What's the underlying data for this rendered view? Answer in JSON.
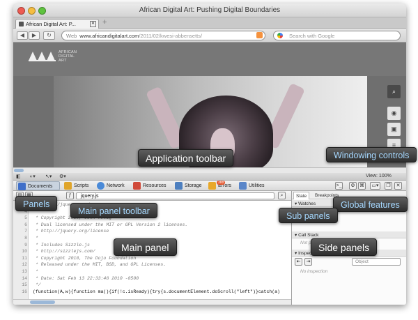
{
  "window": {
    "title": "African Digital Art: Pushing Digital Boundaries",
    "tab_label": "African Digital Art: P...",
    "new_tab": "+"
  },
  "navbar": {
    "back": "◀",
    "forward": "▶",
    "reload": "↻",
    "url_prefix": "Web",
    "url_host": "www.africandigitalart.com",
    "url_path": "/2011/02/kwesi-abbensetts/",
    "search_placeholder": "Search with Google"
  },
  "site": {
    "logo_text": "AFRICAN DIGITAL ART",
    "side_buttons": [
      "search-icon",
      "rss-icon",
      "share-icon",
      "menu-icon"
    ]
  },
  "app_toolbar": {
    "zoom_label": "View: 100%"
  },
  "panels": [
    {
      "label": "Documents",
      "icon": "documents-icon",
      "color": "#3f6fc9"
    },
    {
      "label": "Scripts",
      "icon": "scripts-icon",
      "color": "#e0a52a"
    },
    {
      "label": "Network",
      "icon": "network-icon",
      "color": "#4a8ad8"
    },
    {
      "label": "Resources",
      "icon": "resources-icon",
      "color": "#d04a3a"
    },
    {
      "label": "Storage",
      "icon": "storage-icon",
      "color": "#4d7fbf"
    },
    {
      "label": "Errors",
      "icon": "errors-icon",
      "color": "#e8a82a",
      "badge": "388"
    },
    {
      "label": "Utilities",
      "icon": "utilities-icon",
      "color": "#5a86c9"
    }
  ],
  "main_toolbar": {
    "file": "jquery.js"
  },
  "code": {
    "line_numbers": [
      "3",
      "4",
      "5",
      "6",
      "7",
      "8",
      "9",
      "10",
      "11",
      "12",
      "13",
      "14",
      "15",
      "16"
    ],
    "lines": [
      " * http://jquery.com/",
      " *",
      " * Copyright 2010, John Resig",
      " * Dual licensed under the MIT or GPL Version 2 licenses.",
      " * http://jquery.org/license",
      " *",
      " * Includes Sizzle.js",
      " * http://sizzlejs.com/",
      " * Copyright 2010, The Dojo Foundation",
      " * Released under the MIT, BSD, and GPL Licenses.",
      " *",
      " * Date: Sat Feb 13 22:33:48 2010 -0500",
      " */",
      "(function(A,w){function ma(){if(!c.isReady){try{s.documentElement.doScroll(\"left\")}catch(a)"
    ]
  },
  "side_panel": {
    "tabs": [
      "State",
      "Breakpoints"
    ],
    "sections": [
      {
        "label": "Watches",
        "body": ""
      },
      {
        "label": "Call Stack",
        "body": "Not paused"
      },
      {
        "label": "Inspection",
        "body": "No inspection"
      }
    ],
    "inspect_field": "Object"
  },
  "callouts": {
    "application_toolbar": "Application toolbar",
    "windowing_controls": "Windowing controls",
    "panels": "Panels",
    "main_panel_toolbar": "Main panel toolbar",
    "global_features": "Global features",
    "sub_panels": "Sub panels",
    "main_panel": "Main panel",
    "side_panels": "Side panels"
  }
}
